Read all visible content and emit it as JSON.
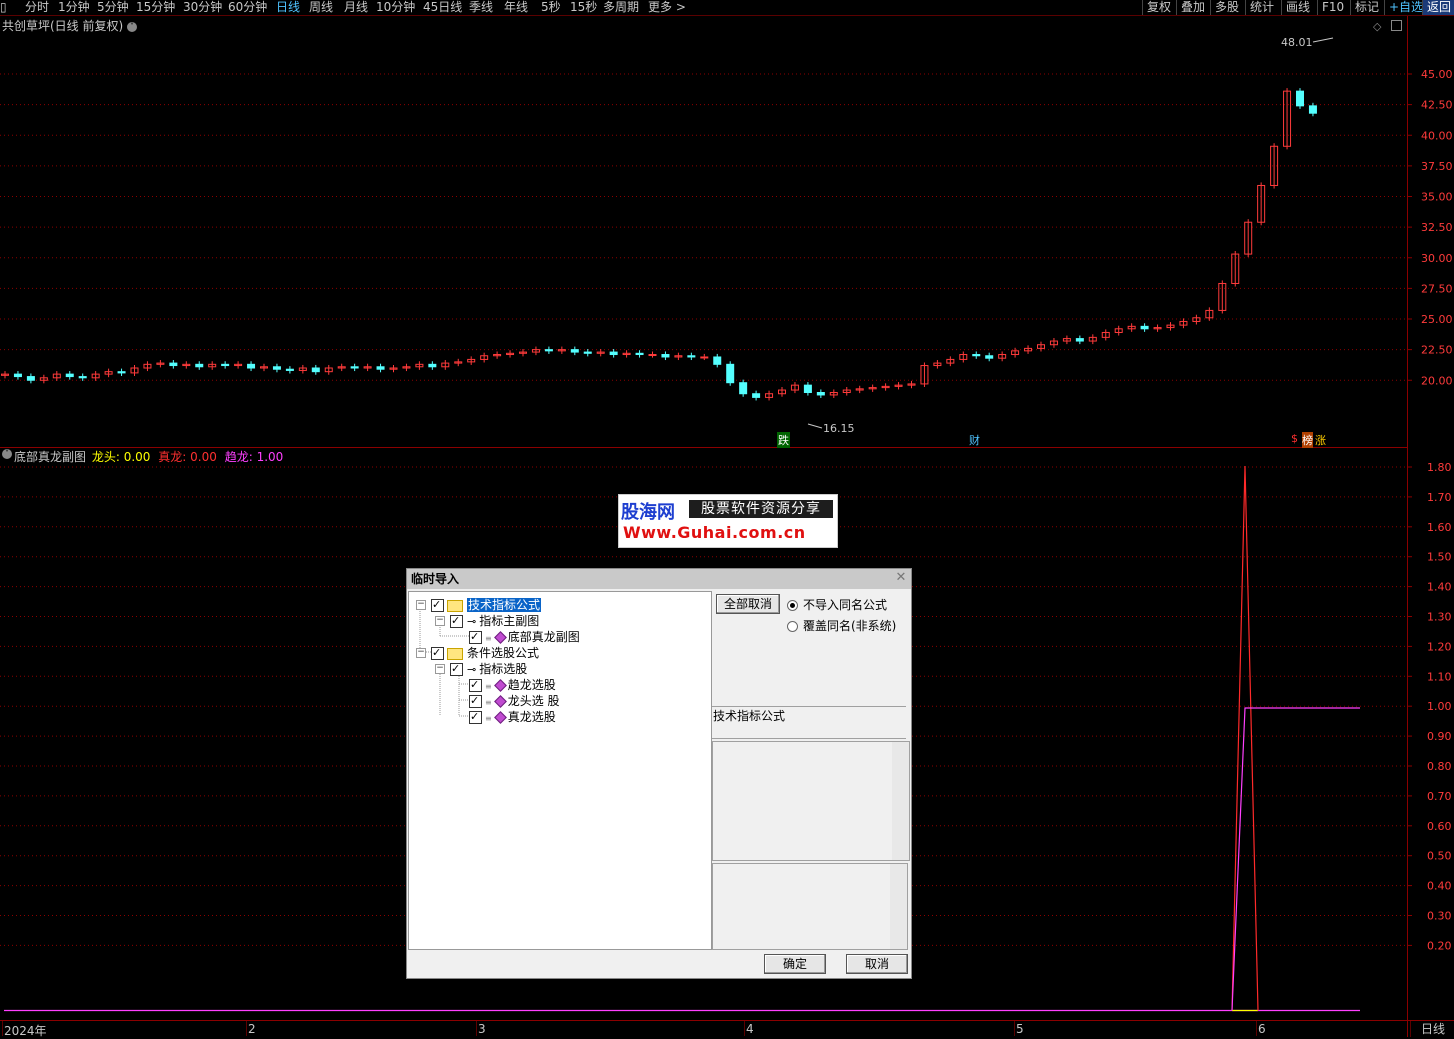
{
  "toolbar": {
    "periods": [
      "分时",
      "1分钟",
      "5分钟",
      "15分钟",
      "30分钟",
      "60分钟",
      "日线",
      "周线",
      "月线",
      "10分钟",
      "45日线",
      "季线",
      "年线",
      "5秒",
      "15秒",
      "多周期",
      "更多 >"
    ],
    "active": "日线",
    "right_buttons": [
      "复权",
      "叠加",
      "多股",
      "统计",
      "画线",
      "F10",
      "标记",
      "+自选",
      "返回"
    ]
  },
  "main_chart": {
    "title": "共创草坪(日线 前复权)",
    "price_ticks": [
      "45.00",
      "42.50",
      "40.00",
      "37.50",
      "35.00",
      "32.50",
      "30.00",
      "27.50",
      "25.00",
      "22.50",
      "20.00"
    ],
    "high_label": "48.01",
    "low_label": "16.15",
    "markers": {
      "die": "跌",
      "cai": "财",
      "dollar": "$",
      "bang": "榜",
      "zhang": "涨"
    },
    "colors": {
      "up": "#ff3b3b",
      "down": "#54ffff",
      "grid": "#8b0000"
    }
  },
  "sub_chart": {
    "title": "底部真龙副图",
    "longtou_label": "龙头:",
    "longtou_value": "0.00",
    "zhenlong_label": "真龙:",
    "zhenlong_value": "0.00",
    "qulong_label": "趋龙:",
    "qulong_value": "1.00",
    "ticks": [
      "1.80",
      "1.70",
      "1.60",
      "1.50",
      "1.40",
      "1.30",
      "1.20",
      "1.10",
      "1.00",
      "0.90",
      "0.80",
      "0.70",
      "0.60",
      "0.50",
      "0.40",
      "0.30",
      "0.20"
    ],
    "series_colors": {
      "longtou": "#ffff00",
      "zhenlong": "#ff2a2a",
      "qulong": "#ff40ff"
    }
  },
  "x_axis": {
    "labels": [
      "2024年",
      "2",
      "3",
      "4",
      "5",
      "6"
    ],
    "period_button": "日线"
  },
  "watermark": {
    "brand": "股海网",
    "slogan": "股票软件资源分享",
    "url": "Www.Guhai.com.cn"
  },
  "dialog": {
    "title": "临时导入",
    "tree": [
      {
        "label": "技术指标公式",
        "level": 0,
        "kind": "folder",
        "selected": true
      },
      {
        "label": "指标主副图",
        "level": 1,
        "kind": "key"
      },
      {
        "label": "底部真龙副图",
        "level": 2,
        "kind": "item"
      },
      {
        "label": "条件选股公式",
        "level": 0,
        "kind": "folder"
      },
      {
        "label": "指标选股",
        "level": 1,
        "kind": "key"
      },
      {
        "label": "趋龙选股",
        "level": 2,
        "kind": "item"
      },
      {
        "label": "龙头选  股",
        "level": 2,
        "kind": "item"
      },
      {
        "label": "真龙选股",
        "level": 2,
        "kind": "item"
      }
    ],
    "cancel_all": "全部取消",
    "radio_no_import": "不导入同名公式",
    "radio_overwrite": "覆盖同名(非系统)",
    "info_label": "技术指标公式",
    "ok": "确定",
    "cancel": "取消"
  }
}
